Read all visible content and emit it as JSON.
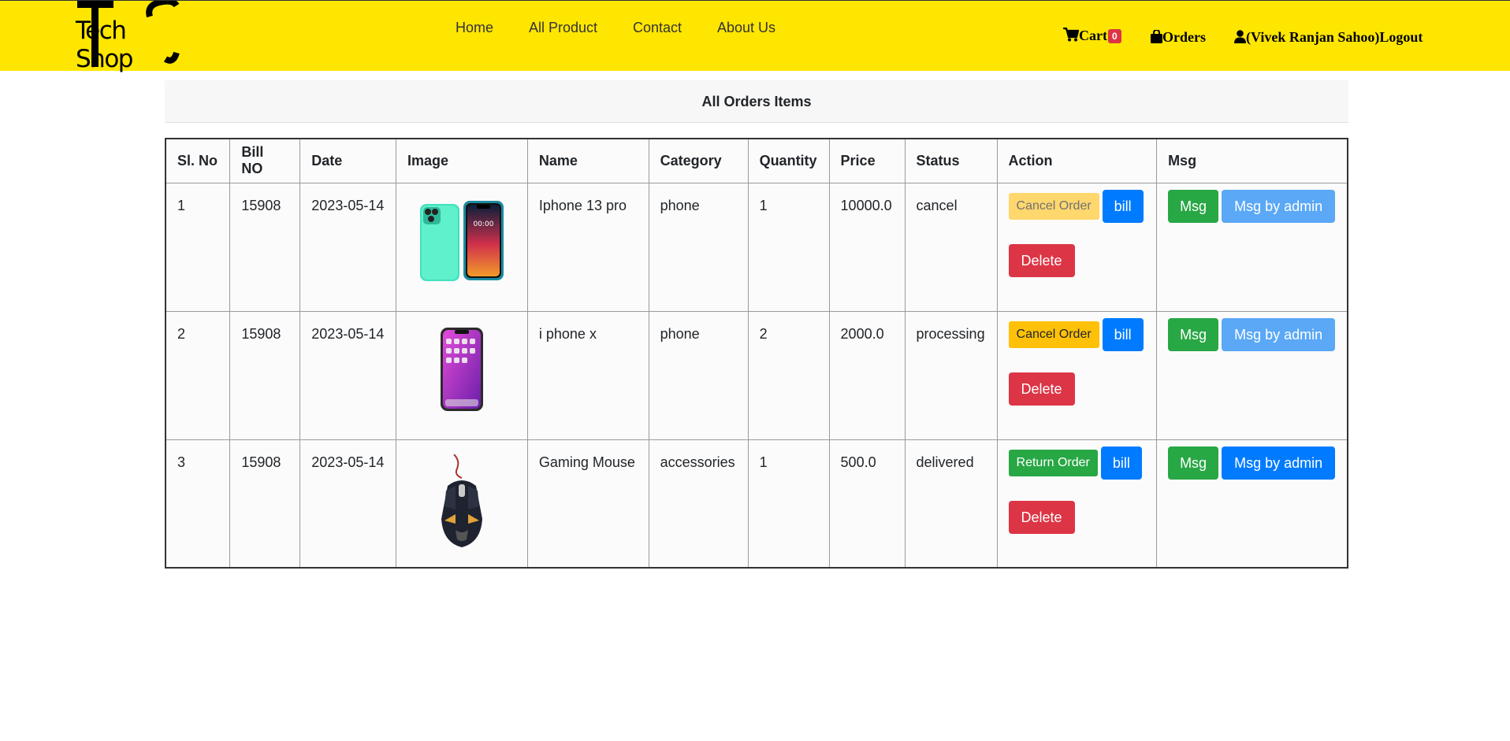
{
  "brand": {
    "name": "Tech Shop",
    "primary": "#ffe600"
  },
  "nav": {
    "items": [
      {
        "label": "Home"
      },
      {
        "label": "All Product"
      },
      {
        "label": "Contact"
      },
      {
        "label": "About Us"
      }
    ]
  },
  "user_nav": {
    "cart_label": "Cart",
    "cart_count": "0",
    "orders_label": "Orders",
    "user_label": "(Vivek Ranjan Sahoo)Logout"
  },
  "page": {
    "title": "All Orders Items"
  },
  "table": {
    "headers": [
      "Sl. No",
      "Bill NO",
      "Date",
      "Image",
      "Name",
      "Category",
      "Quantity",
      "Price",
      "Status",
      "Action",
      "Msg"
    ],
    "rows": [
      {
        "sl": "1",
        "bill": "15908",
        "date": "2023-05-14",
        "image": "phone-teal-image",
        "name": "Iphone 13 pro",
        "category": "phone",
        "quantity": "1",
        "price": "10000.0",
        "status": "cancel",
        "primary_action": "Cancel Order",
        "bill_btn": "bill",
        "delete_btn": "Delete",
        "msg_btn": "Msg",
        "admin_btn": "Msg by admin"
      },
      {
        "sl": "2",
        "bill": "15908",
        "date": "2023-05-14",
        "image": "phone-purple-image",
        "name": "i phone x",
        "category": "phone",
        "quantity": "2",
        "price": "2000.0",
        "status": "processing",
        "primary_action": "Cancel Order",
        "bill_btn": "bill",
        "delete_btn": "Delete",
        "msg_btn": "Msg",
        "admin_btn": "Msg by admin"
      },
      {
        "sl": "3",
        "bill": "15908",
        "date": "2023-05-14",
        "image": "gaming-mouse-image",
        "name": "Gaming Mouse",
        "category": "accessories",
        "quantity": "1",
        "price": "500.0",
        "status": "delivered",
        "primary_action": "Return Order",
        "bill_btn": "bill",
        "delete_btn": "Delete",
        "msg_btn": "Msg",
        "admin_btn": "Msg by admin"
      }
    ]
  }
}
